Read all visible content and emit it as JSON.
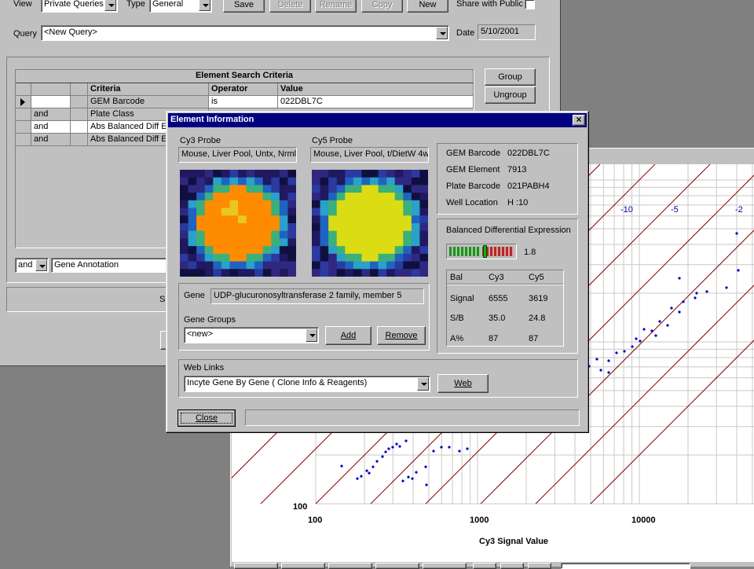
{
  "query_window": {
    "view_label": "View",
    "view_value": "Private Queries",
    "type_label": "Type",
    "type_value": "General",
    "save": "Save",
    "delete": "Delete",
    "rename": "Rename",
    "copy": "Copy",
    "new": "New",
    "share_label": "Share with Public",
    "query_label": "Query",
    "query_value": "<New Query>",
    "date_label": "Date",
    "date_value": "5/10/2001",
    "criteria_title": "Element Search Criteria",
    "columns": [
      "Criteria",
      "Operator",
      "Value"
    ],
    "rows": [
      {
        "conj": "",
        "criteria": "GEM Barcode",
        "operator": "is",
        "value": "022DBL7C"
      },
      {
        "conj": "and",
        "criteria": "Plate Class",
        "operator": "",
        "value": ""
      },
      {
        "conj": "and",
        "criteria": "Abs Balanced Diff E",
        "operator": "",
        "value": ""
      },
      {
        "conj": "and",
        "criteria": "Abs Balanced Diff E",
        "operator": "",
        "value": ""
      }
    ],
    "group": "Group",
    "ungroup": "Ungroup",
    "conj_select": "and",
    "field_select": "Gene Annotation",
    "partial_s": "S"
  },
  "plot": {
    "ytick_100": "100",
    "xticks": [
      "100",
      "1000",
      "10000"
    ],
    "xlabel": "Cy3 Signal Value",
    "diag_labels": [
      "-10",
      "-5",
      "-2"
    ],
    "colors": {
      "grid": "#c8c8c8",
      "diag": "#8b0000",
      "points": "#0000c8",
      "diaglabel": "#0000a0"
    }
  },
  "dialog": {
    "title": "Element Information",
    "cy3_label": "Cy3 Probe",
    "cy3_value": "Mouse, Liver Pool, Untx, Nrml,",
    "cy5_label": "Cy5 Probe",
    "cy5_value": "Mouse, Liver Pool, t/DietW 4w",
    "gem_barcode_label": "GEM Barcode",
    "gem_barcode_value": "022DBL7C",
    "gem_element_label": "GEM Element",
    "gem_element_value": "7913",
    "plate_barcode_label": "Plate Barcode",
    "plate_barcode_value": "021PABH4",
    "well_label": "Well Location",
    "well_value": "H :10",
    "bde_label": "Balanced Differential Expression",
    "bde_value": "1.8",
    "bde_level": 0.55,
    "stats_header": [
      "Bal",
      "Cy3",
      "Cy5"
    ],
    "stats": [
      {
        "label": "Signal",
        "cy3": "6555",
        "cy5": "3619"
      },
      {
        "label": "S/B",
        "cy3": "35.0",
        "cy5": "24.8"
      },
      {
        "label": "A%",
        "cy3": "87",
        "cy5": "87"
      }
    ],
    "gene_label": "Gene",
    "gene_value": "UDP-glucuronosyltransferase 2 family, member 5",
    "gene_groups_label": "Gene Groups",
    "gene_groups_value": "<new>",
    "add": "Add",
    "remove": "Remove",
    "web_links_label": "Web Links",
    "web_links_value": "Incyte Gene By Gene ( Clone Info & Reagents)",
    "web": "Web",
    "close": "Close",
    "colors": {
      "titlebar": "#000080",
      "cy3_spot": "#ff8c00",
      "cy5_spot": "#dcdc14"
    }
  }
}
